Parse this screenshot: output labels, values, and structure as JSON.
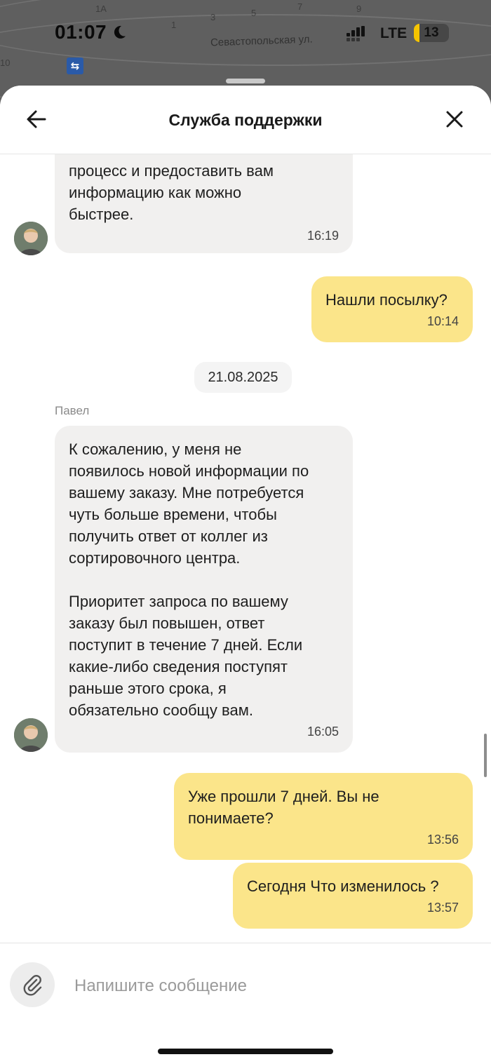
{
  "status_bar": {
    "time": "01:07",
    "network": "LTE",
    "battery": "13",
    "battery_color": "#f5c400"
  },
  "map": {
    "street": "Севастопольская ул.",
    "house_numbers": [
      "1А",
      "1",
      "3",
      "5",
      "7",
      "9",
      "10"
    ]
  },
  "header": {
    "title": "Служба поддержки",
    "back_icon": "arrow-left-icon",
    "close_icon": "close-icon"
  },
  "messages": [
    {
      "from": "agent",
      "text": "процесс и предоставить вам\nинформацию как можно\nбыстрее.",
      "time": "16:19"
    },
    {
      "from": "user",
      "text": "Нашли посылку?",
      "time": "10:14"
    },
    {
      "from": "agent",
      "sender": "Павел",
      "text": "К сожалению, у меня не\nпоявилось новой информации по\nвашему заказу. Мне потребуется\nчуть больше времени, чтобы\nполучить ответ от коллег из\nсортировочного центра.\n\nПриоритет запроса по вашему\nзаказу был повышен, ответ\nпоступит в течение 7 дней. Если\nкакие-либо сведения поступят\nраньше этого срока, я\nобязательно сообщу вам.",
      "time": "16:05"
    },
    {
      "from": "user",
      "text": "Уже прошли 7 дней. Вы не\nпонимаете?",
      "time": "13:56"
    },
    {
      "from": "user",
      "text": "Сегодня Что изменилось ?",
      "time": "13:57"
    }
  ],
  "date_separator": "21.08.2025",
  "composer": {
    "placeholder": "Напишите сообщение",
    "value": "",
    "attach_icon": "paperclip-icon"
  },
  "colors": {
    "user_bubble": "#fbe58a",
    "agent_bubble": "#f1f0ef"
  }
}
